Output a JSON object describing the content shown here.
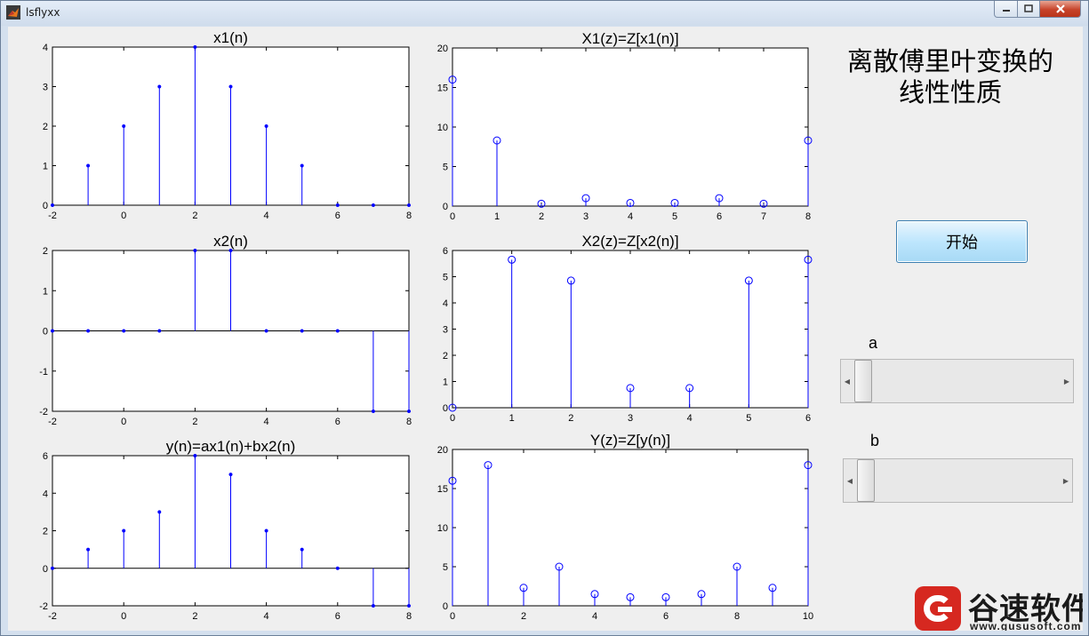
{
  "window": {
    "title": "lsflyxx",
    "controls": {
      "minimize": "minimize-icon",
      "maximize": "maximize-icon",
      "close": "close-icon"
    }
  },
  "panel": {
    "heading_line1": "离散傅里叶变换的",
    "heading_line2": "线性性质",
    "start_button": "开始",
    "slider_a_label": "a",
    "slider_b_label": "b",
    "slider_a_position": 0.0,
    "slider_b_position": 0.0
  },
  "watermark": {
    "name": "谷速软件",
    "url": "www.gususoft.com"
  },
  "colors": {
    "stem": "#0000ff",
    "axes": "#000000",
    "client_bg": "#efefef",
    "plot_bg": "#ffffff",
    "close_button": "#c7432a"
  },
  "chart_data": [
    {
      "id": "x1",
      "type": "stem",
      "title": "x1(n)",
      "xlim": [
        -2,
        8
      ],
      "ylim": [
        0,
        4
      ],
      "xticks": [
        -2,
        0,
        2,
        4,
        6,
        8
      ],
      "yticks": [
        0,
        1,
        2,
        3,
        4
      ],
      "marker": "dot",
      "x": [
        -2,
        -1,
        0,
        1,
        2,
        3,
        4,
        5,
        6,
        7,
        8
      ],
      "y": [
        0,
        1,
        2,
        3,
        4,
        3,
        2,
        1,
        0,
        0,
        0
      ]
    },
    {
      "id": "X1",
      "type": "stem",
      "title": "X1(z)=Z[x1(n)]",
      "xlim": [
        0,
        8
      ],
      "ylim": [
        0,
        20
      ],
      "xticks": [
        0,
        1,
        2,
        3,
        4,
        5,
        6,
        7,
        8
      ],
      "yticks": [
        0,
        5,
        10,
        15,
        20
      ],
      "marker": "circle",
      "x": [
        0,
        1,
        2,
        3,
        4,
        5,
        6,
        7,
        8
      ],
      "y": [
        16,
        8.3,
        0.3,
        1,
        0.4,
        0.4,
        1,
        0.3,
        8.3
      ]
    },
    {
      "id": "x2",
      "type": "stem",
      "title": "x2(n)",
      "xlim": [
        -2,
        8
      ],
      "ylim": [
        -2,
        2
      ],
      "xticks": [
        -2,
        0,
        2,
        4,
        6,
        8
      ],
      "yticks": [
        -2,
        -1,
        0,
        1,
        2
      ],
      "marker": "dot",
      "x": [
        -2,
        -1,
        0,
        1,
        2,
        3,
        4,
        5,
        6,
        7,
        8
      ],
      "y": [
        0,
        0,
        0,
        0,
        2,
        2,
        0,
        0,
        0,
        -2,
        -2
      ]
    },
    {
      "id": "X2",
      "type": "stem",
      "title": "X2(z)=Z[x2(n)]",
      "xlim": [
        0,
        6
      ],
      "ylim": [
        0,
        6
      ],
      "xticks": [
        0,
        1,
        2,
        3,
        4,
        5,
        6
      ],
      "yticks": [
        0,
        1,
        2,
        3,
        4,
        5,
        6
      ],
      "marker": "circle",
      "x": [
        0,
        1,
        2,
        3,
        4,
        5,
        6
      ],
      "y": [
        0,
        5.65,
        4.85,
        0.75,
        0.75,
        4.85,
        5.65
      ]
    },
    {
      "id": "y",
      "type": "stem",
      "title": "y(n)=ax1(n)+bx2(n)",
      "xlim": [
        -2,
        8
      ],
      "ylim": [
        -2,
        6
      ],
      "xticks": [
        -2,
        0,
        2,
        4,
        6,
        8
      ],
      "yticks": [
        -2,
        0,
        2,
        4,
        6
      ],
      "marker": "dot",
      "x": [
        -2,
        -1,
        0,
        1,
        2,
        3,
        4,
        5,
        6,
        7,
        8
      ],
      "y": [
        0,
        1,
        2,
        3,
        6,
        5,
        2,
        1,
        0,
        -2,
        -2
      ]
    },
    {
      "id": "Y",
      "type": "stem",
      "title": "Y(z)=Z[y(n)]",
      "xlim": [
        0,
        10
      ],
      "ylim": [
        0,
        20
      ],
      "xticks": [
        0,
        2,
        4,
        6,
        8,
        10
      ],
      "yticks": [
        0,
        5,
        10,
        15,
        20
      ],
      "marker": "circle",
      "x": [
        0,
        1,
        2,
        3,
        4,
        5,
        6,
        7,
        8,
        9,
        10
      ],
      "y": [
        16,
        18,
        2.3,
        5,
        1.5,
        1.1,
        1.1,
        1.5,
        5,
        2.3,
        18
      ]
    }
  ]
}
